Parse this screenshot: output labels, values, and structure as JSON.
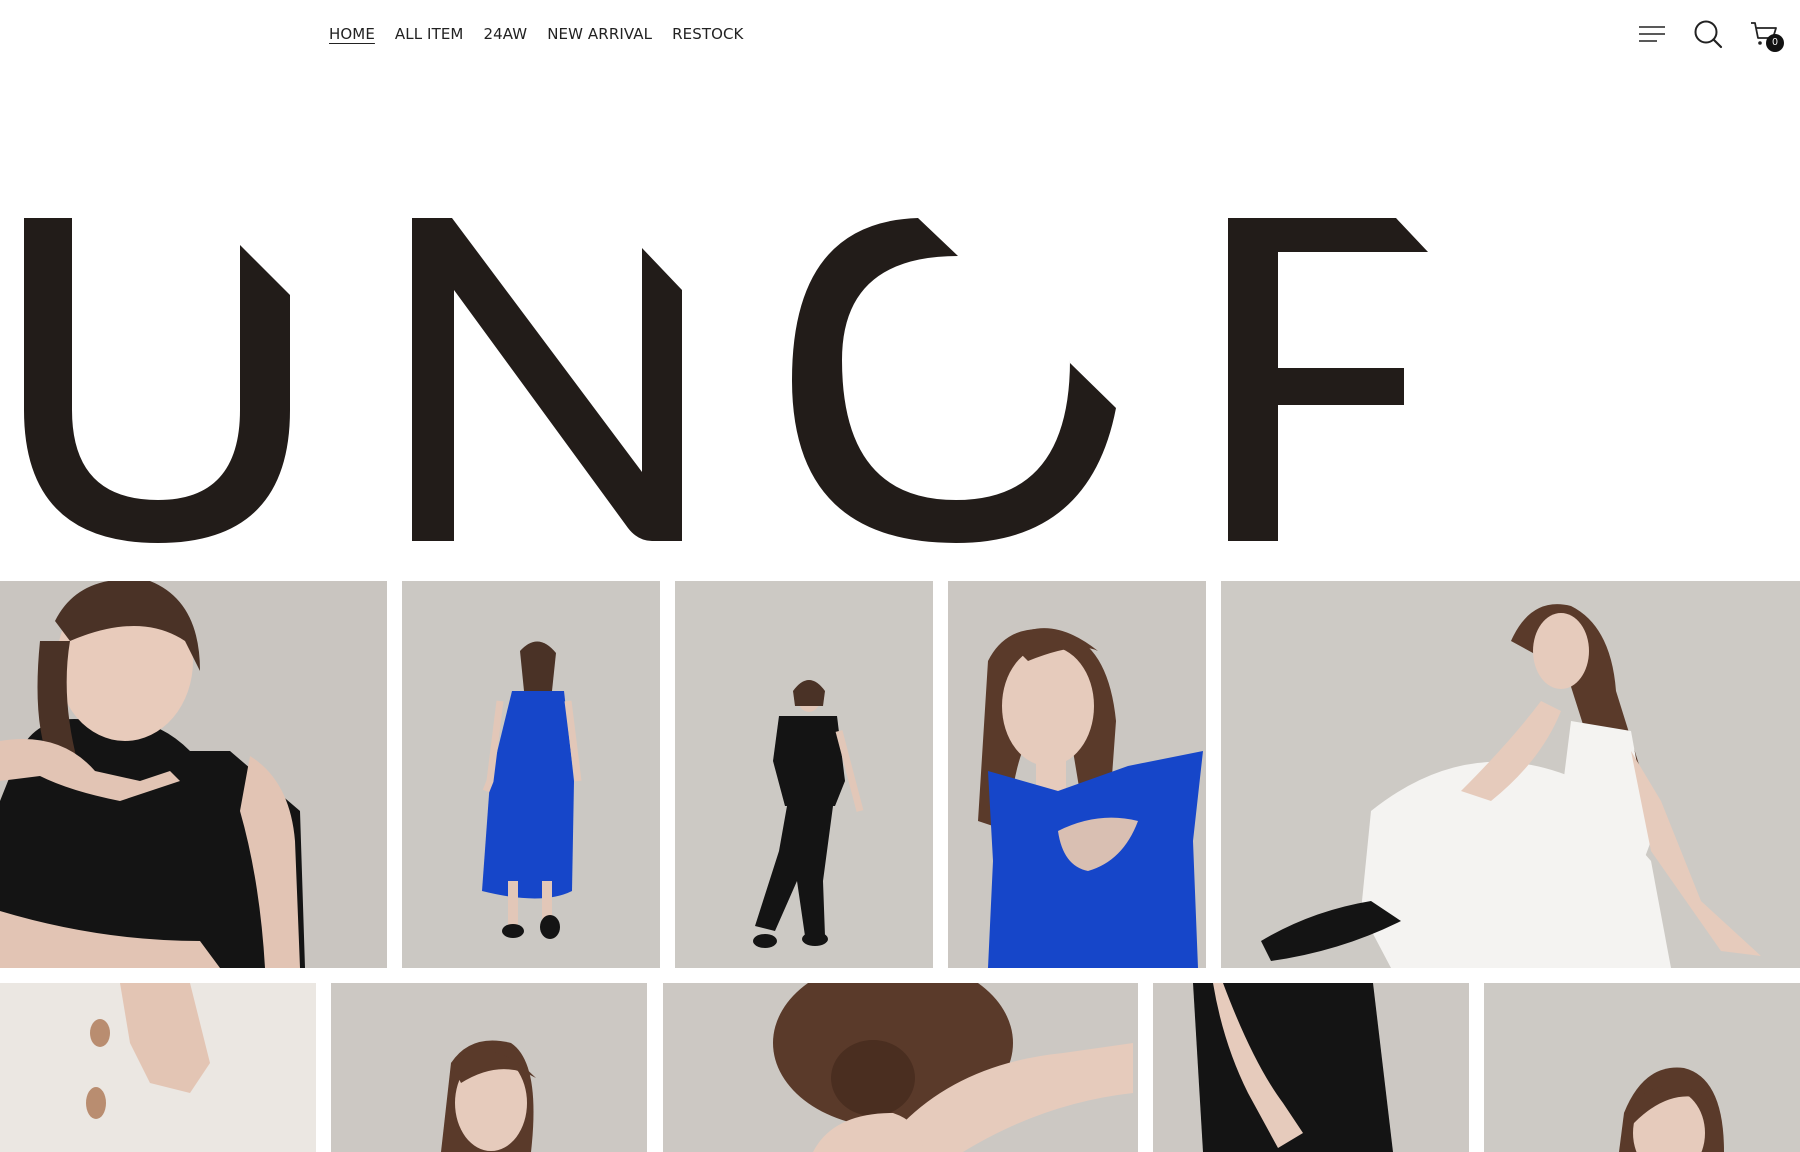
{
  "nav": {
    "items": [
      {
        "label": "HOME",
        "active": true
      },
      {
        "label": "ALL ITEM",
        "active": false
      },
      {
        "label": "24AW",
        "active": false
      },
      {
        "label": "NEW ARRIVAL",
        "active": false
      },
      {
        "label": "RESTOCK",
        "active": false
      }
    ]
  },
  "header_icons": {
    "menu": "menu-icon",
    "search": "search-icon",
    "cart": "cart-icon",
    "cart_count": "0"
  },
  "logo": {
    "text": "UNGF",
    "color": "#221c19"
  },
  "colors": {
    "background": "#ffffff",
    "photo_backdrop": "#c8c4bf",
    "cobalt": "#1646c9",
    "black_garment": "#141414",
    "white_garment": "#f4f3f1"
  },
  "gallery": {
    "row1": [
      {
        "name": "model-black-top-closeup"
      },
      {
        "name": "model-blue-slip-dress"
      },
      {
        "name": "model-black-top-pants"
      },
      {
        "name": "model-blue-cutout-top"
      },
      {
        "name": "model-white-dress-seated"
      }
    ],
    "row2": [
      {
        "name": "detail-white-dress-hand"
      },
      {
        "name": "model-portrait-white"
      },
      {
        "name": "model-hair-bun-back"
      },
      {
        "name": "detail-black-dress"
      },
      {
        "name": "model-portrait-corner"
      }
    ]
  }
}
